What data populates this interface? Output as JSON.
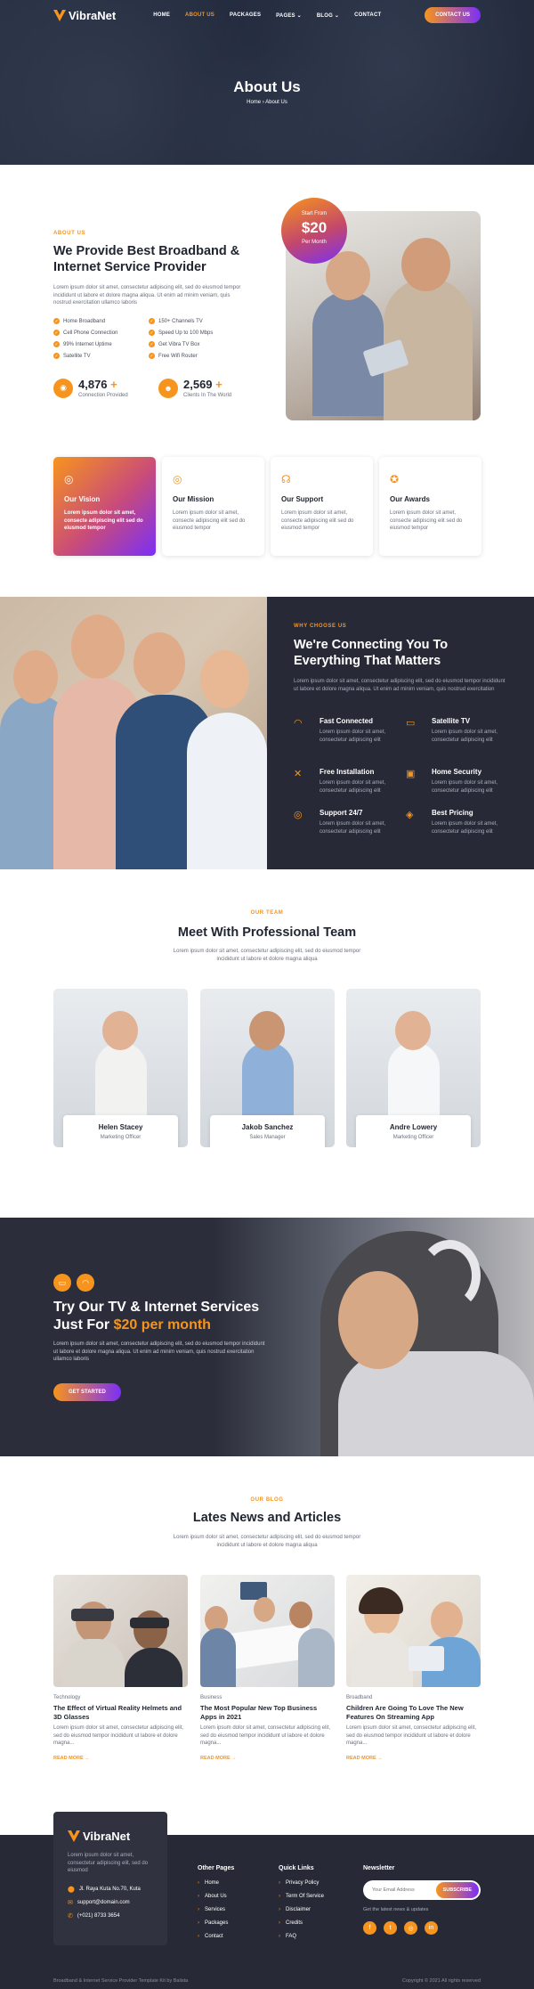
{
  "brand": {
    "name": "VibraNet"
  },
  "nav": {
    "items": [
      "HOME",
      "ABOUT US",
      "PACKAGES",
      "PAGES",
      "BLOG",
      "CONTACT"
    ],
    "cta": "CONTACT US"
  },
  "hero": {
    "title": "About Us",
    "crumb_home": "Home",
    "crumb_current": "About Us"
  },
  "about": {
    "eyebrow": "ABOUT US",
    "title": "We Provide Best Broadband & Internet Service Provider",
    "desc": "Lorem ipsum dolor sit amet, consectetur adipiscing elit, sed do eiusmod tempor incididunt ut labore et dolore magna aliqua. Ut enim ad minim veniam, quis nostrud exercitation ullamco laboris",
    "features": [
      "Home Broadband",
      "150+ Channels TV",
      "Cell Phone Connection",
      "Speed Up to 100 Mbps",
      "99% Internet Uptime",
      "Get Vibra TV Box",
      "Satellite TV",
      "Free Wifi Router"
    ],
    "stats": [
      {
        "value": "4,876",
        "plus": "+",
        "label": "Connection Provided"
      },
      {
        "value": "2,569",
        "plus": "+",
        "label": "Clients In The World"
      }
    ],
    "badge": {
      "top": "Start From",
      "price": "$20",
      "bottom": "Per Month"
    }
  },
  "cards": [
    {
      "title": "Our Vision",
      "desc": "Lorem ipsum dolor sit amet, consecte adipiscing elit sed do eiusmod tempor"
    },
    {
      "title": "Our Mission",
      "desc": "Lorem ipsum dolor sit amet, consecte adipiscing elit sed do eiusmod tempor"
    },
    {
      "title": "Our Support",
      "desc": "Lorem ipsum dolor sit amet, consecte adipiscing elit sed do eiusmod tempor"
    },
    {
      "title": "Our Awards",
      "desc": "Lorem ipsum dolor sit amet, consecte adipiscing elit sed do eiusmod tempor"
    }
  ],
  "why": {
    "eyebrow": "WHY CHOOSE US",
    "title": "We're Connecting You To Everything That Matters",
    "desc": "Lorem ipsum dolor sit amet, consectetur adipiscing elit, sed do eiusmod tempor incididunt ut labore et dolore magna aliqua. Ut enim ad minim veniam, quis nostrud exercitation",
    "features": [
      {
        "title": "Fast Connected",
        "desc": "Lorem ipsum dolor sit amet, consectetur adipiscing elit"
      },
      {
        "title": "Satellite TV",
        "desc": "Lorem ipsum dolor sit amet, consectetur adipiscing elit"
      },
      {
        "title": "Free Installation",
        "desc": "Lorem ipsum dolor sit amet, consectetur adipiscing elit"
      },
      {
        "title": "Home Security",
        "desc": "Lorem ipsum dolor sit amet, consectetur adipiscing elit"
      },
      {
        "title": "Support 24/7",
        "desc": "Lorem ipsum dolor sit amet, consectetur adipiscing elit"
      },
      {
        "title": "Best Pricing",
        "desc": "Lorem ipsum dolor sit amet, consectetur adipiscing elit"
      }
    ]
  },
  "team": {
    "eyebrow": "OUR TEAM",
    "title": "Meet With Professional Team",
    "desc": "Lorem ipsum dolor sit amet, consectetur adipiscing elit, sed do eiusmod tempor incididunt ut labore et dolore magna aliqua",
    "members": [
      {
        "name": "Helen Stacey",
        "role": "Marketing Officer"
      },
      {
        "name": "Jakob Sanchez",
        "role": "Sales Manager"
      },
      {
        "name": "Andre Lowery",
        "role": "Marketing Officer"
      }
    ]
  },
  "promo": {
    "title_line1": "Try Our TV & Internet Services",
    "title_line2": "Just For",
    "price": "$20 per month",
    "desc": "Lorem ipsum dolor sit amet, consectetur adipiscing elit, sed do eiusmod tempor incididunt ut labore et dolore magna aliqua. Ut enim ad minim veniam, quis nostrud exercitation ullamco laboris",
    "button": "GET STARTED"
  },
  "blog": {
    "eyebrow": "OUR BLOG",
    "title": "Lates News and Articles",
    "desc": "Lorem ipsum dolor sit amet, consectetur adipiscing elit, sed do eiusmod tempor incididunt ut labore et dolore magna aliqua",
    "posts": [
      {
        "category": "Technology",
        "title": "The Effect of Virtual Reality Helmets and 3D Glasses",
        "excerpt": "Lorem ipsum dolor sit amet, consectetur adipiscing elit, sed do eiusmod tempor incididunt ut labore et dolore magna...",
        "more": "READ MORE →"
      },
      {
        "category": "Business",
        "title": "The Most Popular New Top Business Apps in 2021",
        "excerpt": "Lorem ipsum dolor sit amet, consectetur adipiscing elit, sed do eiusmod tempor incididunt ut labore et dolore magna...",
        "more": "READ MORE →"
      },
      {
        "category": "Broadband",
        "title": "Children Are Going To Love The New Features On Streaming App",
        "excerpt": "Lorem ipsum dolor sit amet, consectetur adipiscing elit, sed do eiusmod tempor incididunt ut labore et dolore magna...",
        "more": "READ MORE →"
      }
    ]
  },
  "footer": {
    "desc": "Lorem ipsum dolor sit amet, consectetur adipiscing elit, sed do eiusmod",
    "address": "Jl. Raya Kuta No.70, Kuta",
    "email": "support@domain.com",
    "phone": "(+021) 8733 3654",
    "other_title": "Other Pages",
    "other": [
      "Home",
      "About Us",
      "Services",
      "Packages",
      "Contact"
    ],
    "quick_title": "Quick Links",
    "quick": [
      "Privacy Policy",
      "Term Of Service",
      "Disclaimer",
      "Credits",
      "FAQ"
    ],
    "news_title": "Newsletter",
    "news_placeholder": "Your Email Address",
    "news_button": "SUBSCRIBE",
    "news_sub": "Get the latest news & updates",
    "bottom_left": "Broadband & Internet Service Provider Template Kit by Balista",
    "bottom_right": "Copyright © 2021 All rights reserved"
  },
  "colors": {
    "accent": "#f7941d",
    "purple": "#7b2ff7",
    "dark": "#272a36"
  }
}
